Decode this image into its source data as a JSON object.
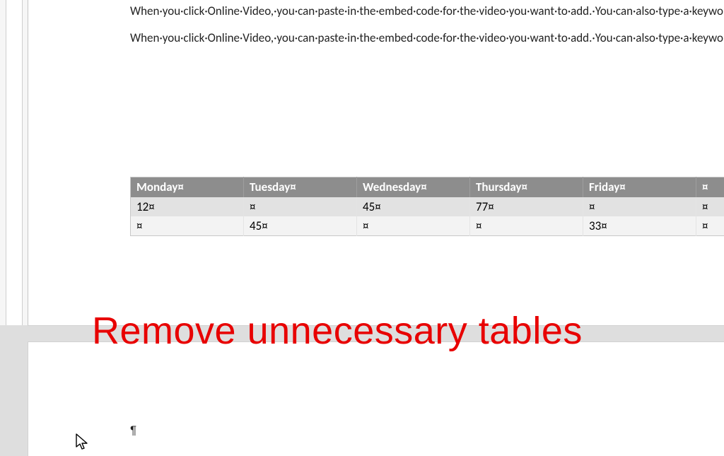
{
  "paragraphs": {
    "p1": "When·you·click·Online·Video,·you·can·paste·in·the·embed·code·for·the·video·you·want·to·add.·You·can·also·type·a·keyword·to·search·online·for·the·video·that·best·fits·your·document.·To·change·the·way·a·picture·fits·in·your·document,·click·it·and·a·button·for·layout·options·appears·next·to·it.·When·you·work·on·a·table,·click·where·you·want·to·add·a·row·or·a·column,·and·then·click·the·plus·sign.·Reading·is·easier,·too,·in·the·new·Reading·view.·You·can·collapse·parts·of·the·document·and·focus·on·the·text·you·want.·¶",
    "p2": "When·you·click·Online·Video,·you·can·paste·in·the·embed·code·for·the·video·you·want·to·add.·You·can·also·type·a·keyword·to·search·online·for·the·video·that·best·fits·your·document.·Try·this·for·example.¶"
  },
  "table": {
    "headers": [
      "Monday¤",
      "Tuesday¤",
      "Wednesday¤",
      "Thursday¤",
      "Friday¤",
      "¤"
    ],
    "rows": [
      [
        "12¤",
        "¤",
        "45¤",
        "77¤",
        "¤",
        "¤"
      ],
      [
        "¤",
        "45¤",
        "¤",
        "¤",
        "33¤",
        "¤"
      ]
    ]
  },
  "overlay": {
    "caption": "Remove unnecessary tables"
  },
  "page2": {
    "empty_para_mark": "¶"
  },
  "icons": {
    "cursor": "arrow-cursor"
  },
  "colors": {
    "accent_red": "#e80000",
    "header_bg": "#8d8d8d"
  }
}
